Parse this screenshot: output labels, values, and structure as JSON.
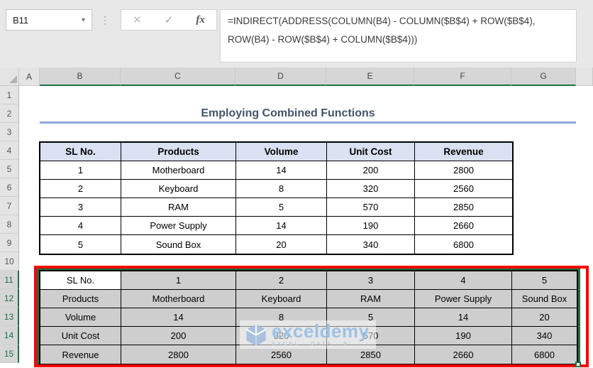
{
  "formula_bar": {
    "name_box_value": "B11",
    "cancel_icon": "✕",
    "enter_icon": "✓",
    "insert_function_label": "fx",
    "kebab_icon": "⋮",
    "dropdown_icon": "▾",
    "formula_line1": "=INDIRECT(ADDRESS(COLUMN(B4) - COLUMN($B$4) + ROW($B$4),",
    "formula_line2": "ROW(B4) - ROW($B$4) + COLUMN($B$4)))"
  },
  "grid": {
    "column_headers": [
      "A",
      "B",
      "C",
      "D",
      "E",
      "F",
      "G"
    ],
    "selected_columns": [
      "B",
      "C",
      "D",
      "E",
      "F",
      "G"
    ],
    "row_headers": [
      "1",
      "2",
      "3",
      "4",
      "5",
      "6",
      "7",
      "8",
      "9",
      "10",
      "11",
      "12",
      "13",
      "14",
      "15"
    ],
    "selected_rows": [
      "11",
      "12",
      "13",
      "14",
      "15"
    ],
    "active_cell": "B11"
  },
  "sheet": {
    "title": "Employing Combined Functions",
    "source_table": {
      "headers": [
        "SL No.",
        "Products",
        "Volume",
        "Unit Cost",
        "Revenue"
      ],
      "rows": [
        [
          "1",
          "Motherboard",
          "14",
          "200",
          "2800"
        ],
        [
          "2",
          "Keyboard",
          "8",
          "320",
          "2560"
        ],
        [
          "3",
          "RAM",
          "5",
          "570",
          "2850"
        ],
        [
          "4",
          "Power Supply",
          "14",
          "190",
          "2660"
        ],
        [
          "5",
          "Sound Box",
          "20",
          "340",
          "6800"
        ]
      ]
    },
    "transposed_table": {
      "rows": [
        [
          "SL No.",
          "1",
          "2",
          "3",
          "4",
          "5"
        ],
        [
          "Products",
          "Motherboard",
          "Keyboard",
          "RAM",
          "Power Supply",
          "Sound Box"
        ],
        [
          "Volume",
          "14",
          "8",
          "5",
          "14",
          "20"
        ],
        [
          "Unit Cost",
          "200",
          "320",
          "570",
          "190",
          "340"
        ],
        [
          "Revenue",
          "2800",
          "2560",
          "2850",
          "2660",
          "6800"
        ]
      ]
    }
  },
  "watermark": {
    "brand": "exceldemy",
    "tagline": "EXCEL - DATA - BI"
  },
  "colors": {
    "excel_green": "#1E7145",
    "annotation_red": "#FF0000",
    "table_header_fill": "#D9E1F2",
    "selection_fill": "#CECECE",
    "title_text": "#44546A",
    "title_underline": "#8EA9DB"
  }
}
